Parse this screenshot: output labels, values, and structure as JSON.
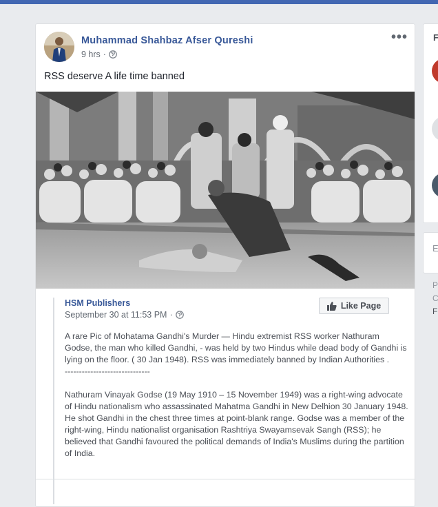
{
  "post": {
    "author": "Muhammad Shahbaz Afser Qureshi",
    "time": "9 hrs",
    "separator": "·",
    "text": "RSS deserve A life time banned",
    "more_label": "•••",
    "icons": {
      "privacy": "globe-icon",
      "more": "more-options-icon"
    }
  },
  "shared": {
    "page_name": "HSM Publishers",
    "time": "September 30 at 11:53 PM",
    "separator": "·",
    "like_page_label": "Like Page",
    "like_icon": "thumbs-up-icon",
    "description": "A rare Pic of Mohatama Gandhi's Murder — Hindu extremist RSS worker Nathuram Godse, the man who killed Gandhi, - was held by two Hindus while dead body of Gandhi is lying on the floor. ( 30 Jan 1948). RSS was immediately banned by Indian Authorities .\n------------------------------\n\nNathuram Vinayak Godse (19 May 1910 – 15 November 1949) was a right-wing advocate of Hindu nationalism who assassinated Mahatma Gandhi in New Delhion 30 January 1948. He shot Gandhi in the chest three times at point-blank range. Godse was a member of the right-wing, Hindu nationalist organisation Rashtriya Swayamsevak Sangh (RSS); he believed that Gandhi favoured the political demands of India's Muslims during the partition of India."
  },
  "sidebar": {
    "top_letter": "F",
    "box2_letter": "E",
    "foot": [
      "P",
      "C",
      "F"
    ]
  },
  "colors": {
    "brand": "#4267b2",
    "link": "#385898",
    "background": "#e9ebee"
  }
}
